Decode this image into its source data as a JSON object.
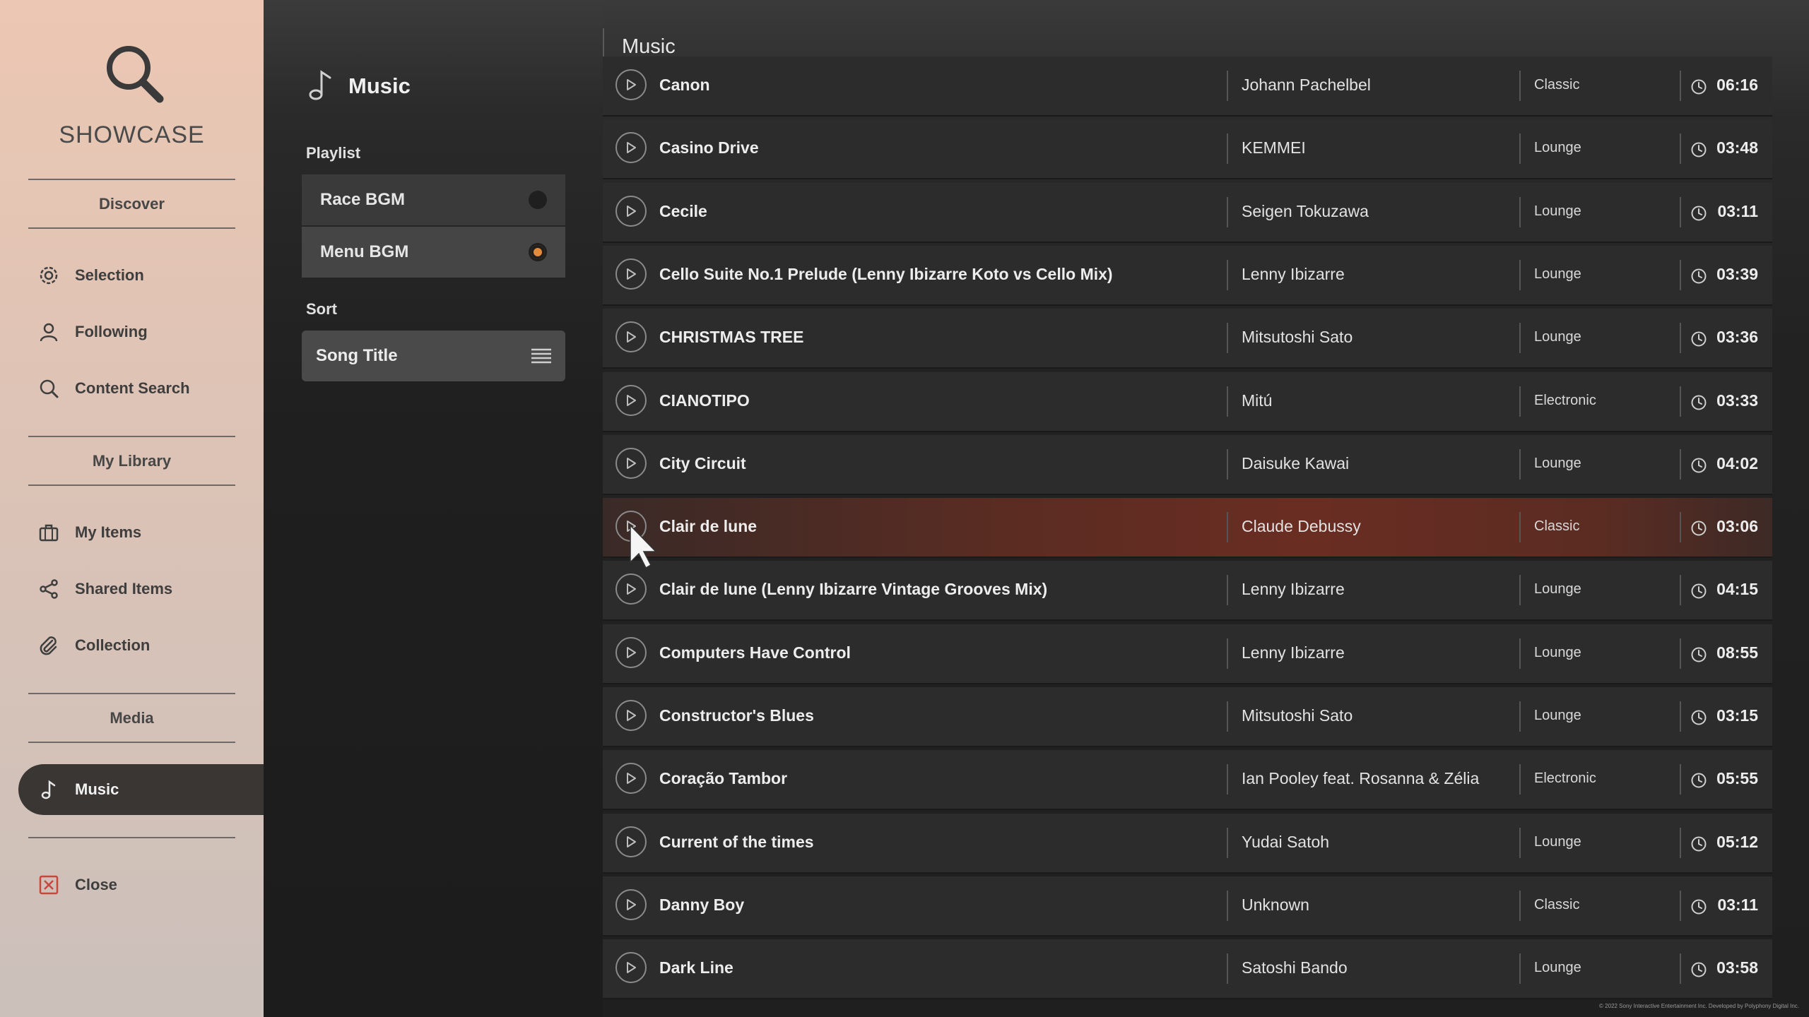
{
  "sidebar": {
    "logo_text": "SHOWCASE",
    "sections": {
      "discover": "Discover",
      "library": "My Library",
      "media": "Media"
    },
    "items": [
      {
        "label": "Selection",
        "icon": "gear-icon"
      },
      {
        "label": "Following",
        "icon": "person-icon"
      },
      {
        "label": "Content Search",
        "icon": "search-icon"
      },
      {
        "label": "My Items",
        "icon": "briefcase-icon"
      },
      {
        "label": "Shared Items",
        "icon": "share-icon"
      },
      {
        "label": "Collection",
        "icon": "paperclip-icon"
      },
      {
        "label": "Music",
        "icon": "music-note-icon",
        "active": true
      },
      {
        "label": "Close",
        "icon": "close-icon"
      }
    ]
  },
  "middle": {
    "title": "Music",
    "playlist_label": "Playlist",
    "playlists": [
      {
        "label": "Race BGM",
        "selected": false
      },
      {
        "label": "Menu BGM",
        "selected": true
      }
    ],
    "sort_label": "Sort",
    "sort_value": "Song Title"
  },
  "list": {
    "heading": "Music",
    "tracks": [
      {
        "title": "Canon",
        "artist": "Johann Pachelbel",
        "genre": "Classic",
        "duration": "06:16"
      },
      {
        "title": "Casino Drive",
        "artist": "KEMMEI",
        "genre": "Lounge",
        "duration": "03:48"
      },
      {
        "title": "Cecile",
        "artist": "Seigen Tokuzawa",
        "genre": "Lounge",
        "duration": "03:11"
      },
      {
        "title": "Cello Suite No.1 Prelude (Lenny Ibizarre Koto vs Cello Mix)",
        "artist": "Lenny Ibizarre",
        "genre": "Lounge",
        "duration": "03:39"
      },
      {
        "title": "CHRISTMAS TREE",
        "artist": "Mitsutoshi Sato",
        "genre": "Lounge",
        "duration": "03:36"
      },
      {
        "title": "CIANOTIPO",
        "artist": "Mitú",
        "genre": "Electronic",
        "duration": "03:33"
      },
      {
        "title": "City Circuit",
        "artist": "Daisuke Kawai",
        "genre": "Lounge",
        "duration": "04:02"
      },
      {
        "title": "Clair de lune",
        "artist": "Claude Debussy",
        "genre": "Classic",
        "duration": "03:06",
        "selected": true
      },
      {
        "title": "Clair de lune (Lenny Ibizarre Vintage Grooves Mix)",
        "artist": "Lenny Ibizarre",
        "genre": "Lounge",
        "duration": "04:15"
      },
      {
        "title": "Computers Have Control",
        "artist": "Lenny Ibizarre",
        "genre": "Lounge",
        "duration": "08:55"
      },
      {
        "title": "Constructor's Blues",
        "artist": "Mitsutoshi Sato",
        "genre": "Lounge",
        "duration": "03:15"
      },
      {
        "title": "Coração Tambor",
        "artist": "Ian Pooley feat. Rosanna & Zélia",
        "genre": "Electronic",
        "duration": "05:55"
      },
      {
        "title": "Current of the times",
        "artist": "Yudai Satoh",
        "genre": "Lounge",
        "duration": "05:12"
      },
      {
        "title": "Danny Boy",
        "artist": "Unknown",
        "genre": "Classic",
        "duration": "03:11"
      },
      {
        "title": "Dark Line",
        "artist": "Satoshi Bando",
        "genre": "Lounge",
        "duration": "03:58"
      }
    ]
  },
  "footer": {
    "copyright": "© 2022 Sony Interactive Entertainment Inc. Developed by Polyphony Digital Inc."
  },
  "colors": {
    "accent": "#e58a3a",
    "selected_row": "#6a2d22",
    "sidebar_active": "#3a3634"
  }
}
